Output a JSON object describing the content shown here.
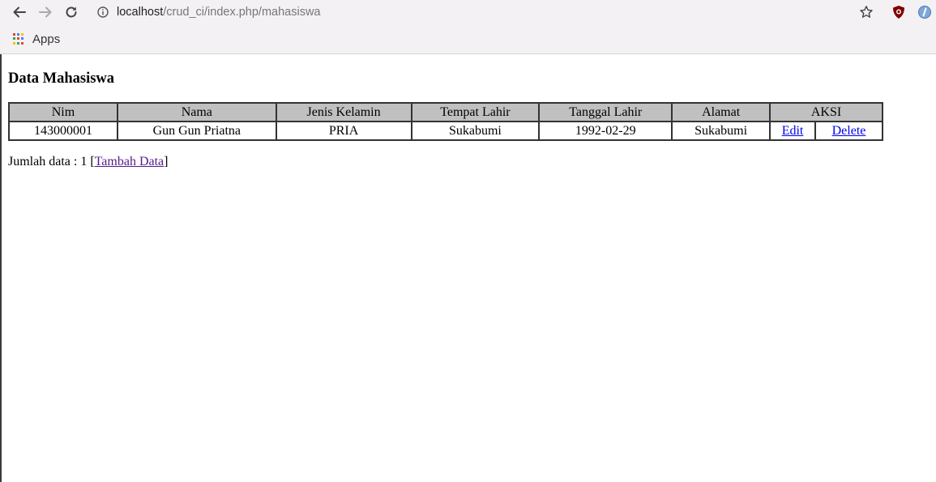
{
  "browser": {
    "url_host": "localhost",
    "url_path": "/crud_ci/index.php/mahasiswa",
    "bookmark_apps": "Apps"
  },
  "page": {
    "title": "Data Mahasiswa",
    "table": {
      "headers": [
        "Nim",
        "Nama",
        "Jenis Kelamin",
        "Tempat Lahir",
        "Tanggal Lahir",
        "Alamat",
        "AKSI"
      ],
      "rows": [
        {
          "nim": "143000001",
          "nama": "Gun Gun Priatna",
          "jenis_kelamin": "PRIA",
          "tempat_lahir": "Sukabumi",
          "tanggal_lahir": "1992-02-29",
          "alamat": "Sukabumi",
          "edit_label": "Edit",
          "delete_label": "Delete"
        }
      ]
    },
    "footer": {
      "count_label": "Jumlah data : 1 [",
      "add_link": "Tambah Data",
      "close_bracket": "]"
    }
  },
  "colors": {
    "header_bg": "#c0c0c0",
    "link": "#0000ee",
    "visited_link": "#551a8b"
  }
}
